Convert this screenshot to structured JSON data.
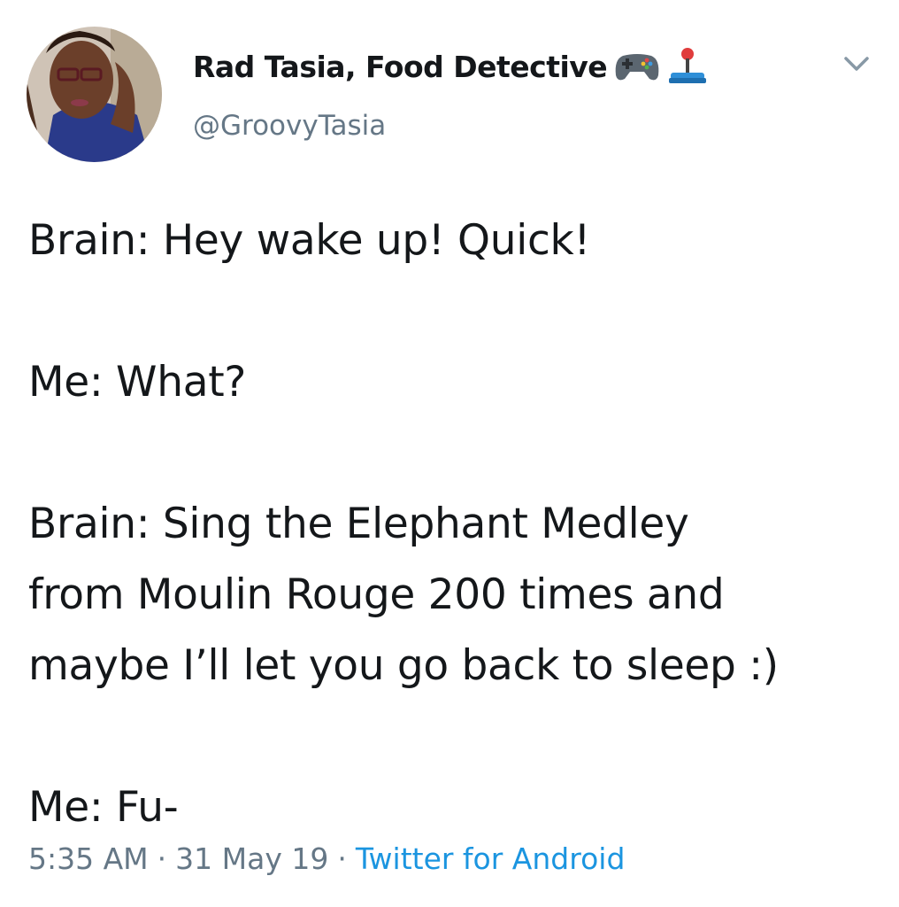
{
  "author": {
    "display_name": "Rad Tasia, Food Detective",
    "handle": "@GroovyTasia",
    "emoji_icons": [
      "video-game-icon",
      "joystick-icon"
    ]
  },
  "tweet": {
    "lines": [
      "Brain: Hey wake up! Quick!",
      "Me: What?",
      "Brain: Sing the Elephant Medley",
      "from Moulin Rouge 200 times and",
      "maybe I’ll let you go back to sleep :)",
      "Me: Fu-"
    ]
  },
  "meta": {
    "time": "5:35 AM",
    "separator": "·",
    "date": "31 May 19",
    "source": "Twitter for Android"
  },
  "colors": {
    "text": "#14171a",
    "secondary": "#657786",
    "link": "#1b95e0"
  }
}
